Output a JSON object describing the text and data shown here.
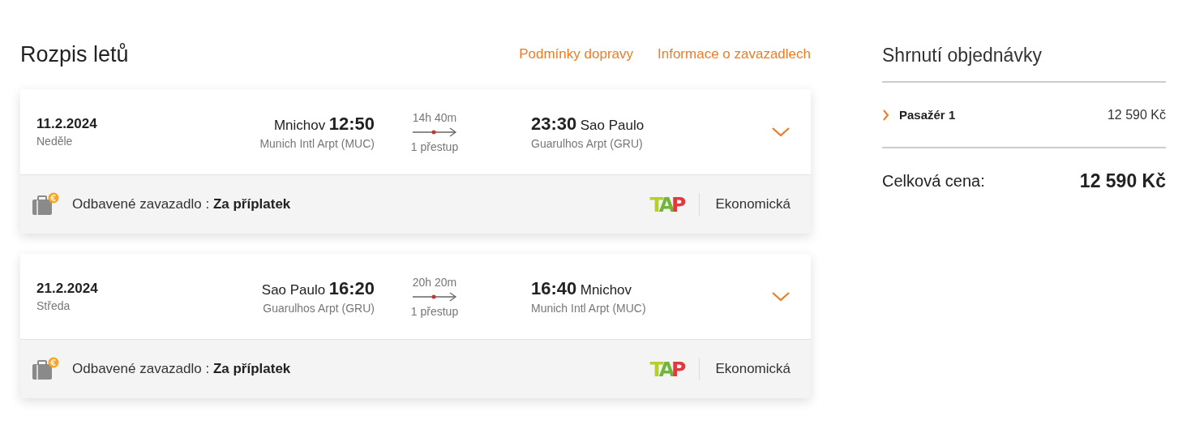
{
  "title": "Rozpis letů",
  "links": [
    "Podmínky dopravy",
    "Informace o zavazadlech"
  ],
  "flights": [
    {
      "date": "11.2.2024",
      "weekday": "Neděle",
      "from_city": "Mnichov",
      "from_time": "12:50",
      "from_airport": "Munich Intl Arpt (MUC)",
      "duration": "14h 40m",
      "stops": "1 přestup",
      "to_time": "23:30",
      "to_city": "Sao Paulo",
      "to_airport": "Guarulhos Arpt (GRU)",
      "expanded": false,
      "baggage_label": "Odbavené zavazadlo :",
      "baggage_value": "Za příplatek",
      "airline_logo": "TAP",
      "cabin": "Ekonomická"
    },
    {
      "date": "21.2.2024",
      "weekday": "Středa",
      "from_city": "Sao Paulo",
      "from_time": "16:20",
      "from_airport": "Guarulhos Arpt (GRU)",
      "duration": "20h 20m",
      "stops": "1 přestup",
      "to_time": "16:40",
      "to_city": "Mnichov",
      "to_airport": "Munich Intl Arpt (MUC)",
      "expanded": false,
      "baggage_label": "Odbavené zavazadlo :",
      "baggage_value": "Za příplatek",
      "airline_logo": "TAP",
      "cabin": "Ekonomická"
    }
  ],
  "summary": {
    "title": "Shrnutí objednávky",
    "passengers": [
      {
        "label": "Pasažér 1",
        "price": "12 590 Kč",
        "expanded": false
      }
    ],
    "total_label": "Celková cena:",
    "total_value": "12 590 Kč"
  }
}
